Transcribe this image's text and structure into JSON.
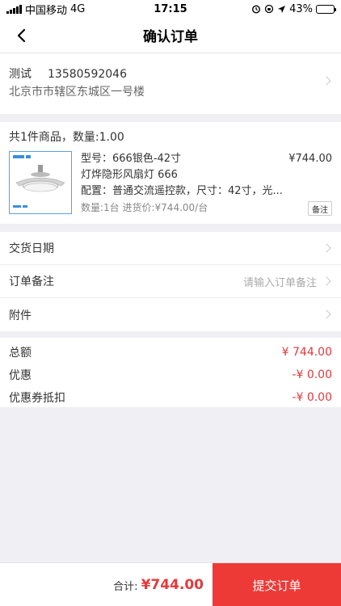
{
  "status": {
    "carrier": "中国移动",
    "network": "4G",
    "time": "17:15",
    "battery_pct": "43%",
    "battery_level": 0.43
  },
  "nav": {
    "title": "确认订单"
  },
  "address": {
    "name": "测试",
    "phone": "13580592046",
    "detail": "北京市市辖区东城区一号楼"
  },
  "goods": {
    "summary": "共1件商品，数量:1.00",
    "model": "型号：666银色-42寸",
    "price": "¥744.00",
    "name": "灯烨隐形风扇灯 666",
    "config": "配置：普通交流遥控款，尺寸：42寸，光...",
    "qty": "数量:1台 进货价:¥744.00/台",
    "note_label": "备注"
  },
  "options": {
    "delivery_label": "交货日期",
    "remark_label": "订单备注",
    "remark_placeholder": "请输入订单备注",
    "attachment_label": "附件"
  },
  "totals": {
    "total_label": "总额",
    "total_value": "¥ 744.00",
    "discount_label": "优惠",
    "discount_value": "-¥ 0.00",
    "coupon_label": "优惠券抵扣",
    "coupon_value": "-¥ 0.00"
  },
  "footer": {
    "sum_label": "合计:",
    "sum_amount": "¥744.00",
    "submit_label": "提交订单"
  },
  "colors": {
    "accent": "#ee3a37",
    "price_red": "#e4393c",
    "background": "#efeff4"
  }
}
